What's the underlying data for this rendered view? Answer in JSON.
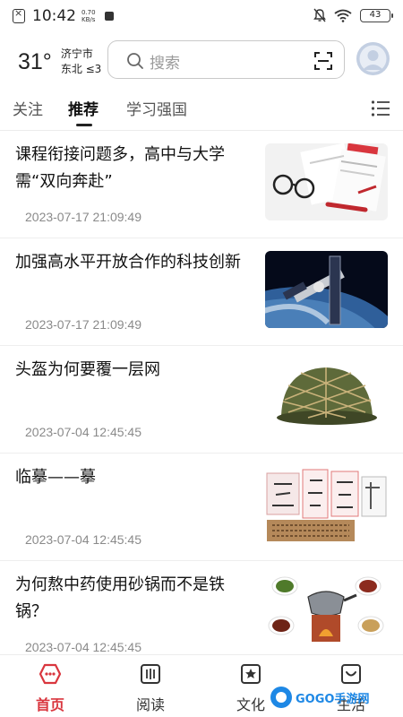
{
  "status_bar": {
    "time": "10:42",
    "net_speed_value": "0.70",
    "net_speed_unit": "KB/s",
    "battery": "43"
  },
  "header": {
    "temperature": "31°",
    "city": "济宁市",
    "wind": "东北 ≤3",
    "search_placeholder": "搜索"
  },
  "tabs": [
    {
      "label": "关注"
    },
    {
      "label": "推荐"
    },
    {
      "label": "学习强国"
    }
  ],
  "feed": [
    {
      "title": "课程衔接问题多，高中与大学需“双向奔赴”",
      "time": "2023-07-17 21:09:49",
      "image": "glasses-and-documents"
    },
    {
      "title": "加强高水平开放合作的科技创新",
      "time": "2023-07-17 21:09:49",
      "image": "space-station"
    },
    {
      "title": "头盔为何要覆一层网",
      "time": "2023-07-04 12:45:45",
      "image": "netted-helmet"
    },
    {
      "title": "临摹——摹",
      "time": "2023-07-04 12:45:45",
      "image": "calligraphy-copybooks"
    },
    {
      "title": "为何熬中药使用砂锅而不是铁锅？",
      "time": "2023-07-04 12:45:45",
      "image": "herbal-clay-pot"
    }
  ],
  "bottom_nav": [
    {
      "label": "首页",
      "icon": "home-icon",
      "active": true
    },
    {
      "label": "阅读",
      "icon": "book-icon",
      "active": false
    },
    {
      "label": "文化",
      "icon": "star-badge-icon",
      "active": false
    },
    {
      "label": "生活",
      "icon": "cup-icon",
      "active": false
    }
  ],
  "watermark": {
    "text": "GOGO手游网"
  },
  "colors": {
    "accent": "#d9363e",
    "text": "#111111",
    "muted": "#8a8a8a",
    "divider": "#eeeeee"
  }
}
